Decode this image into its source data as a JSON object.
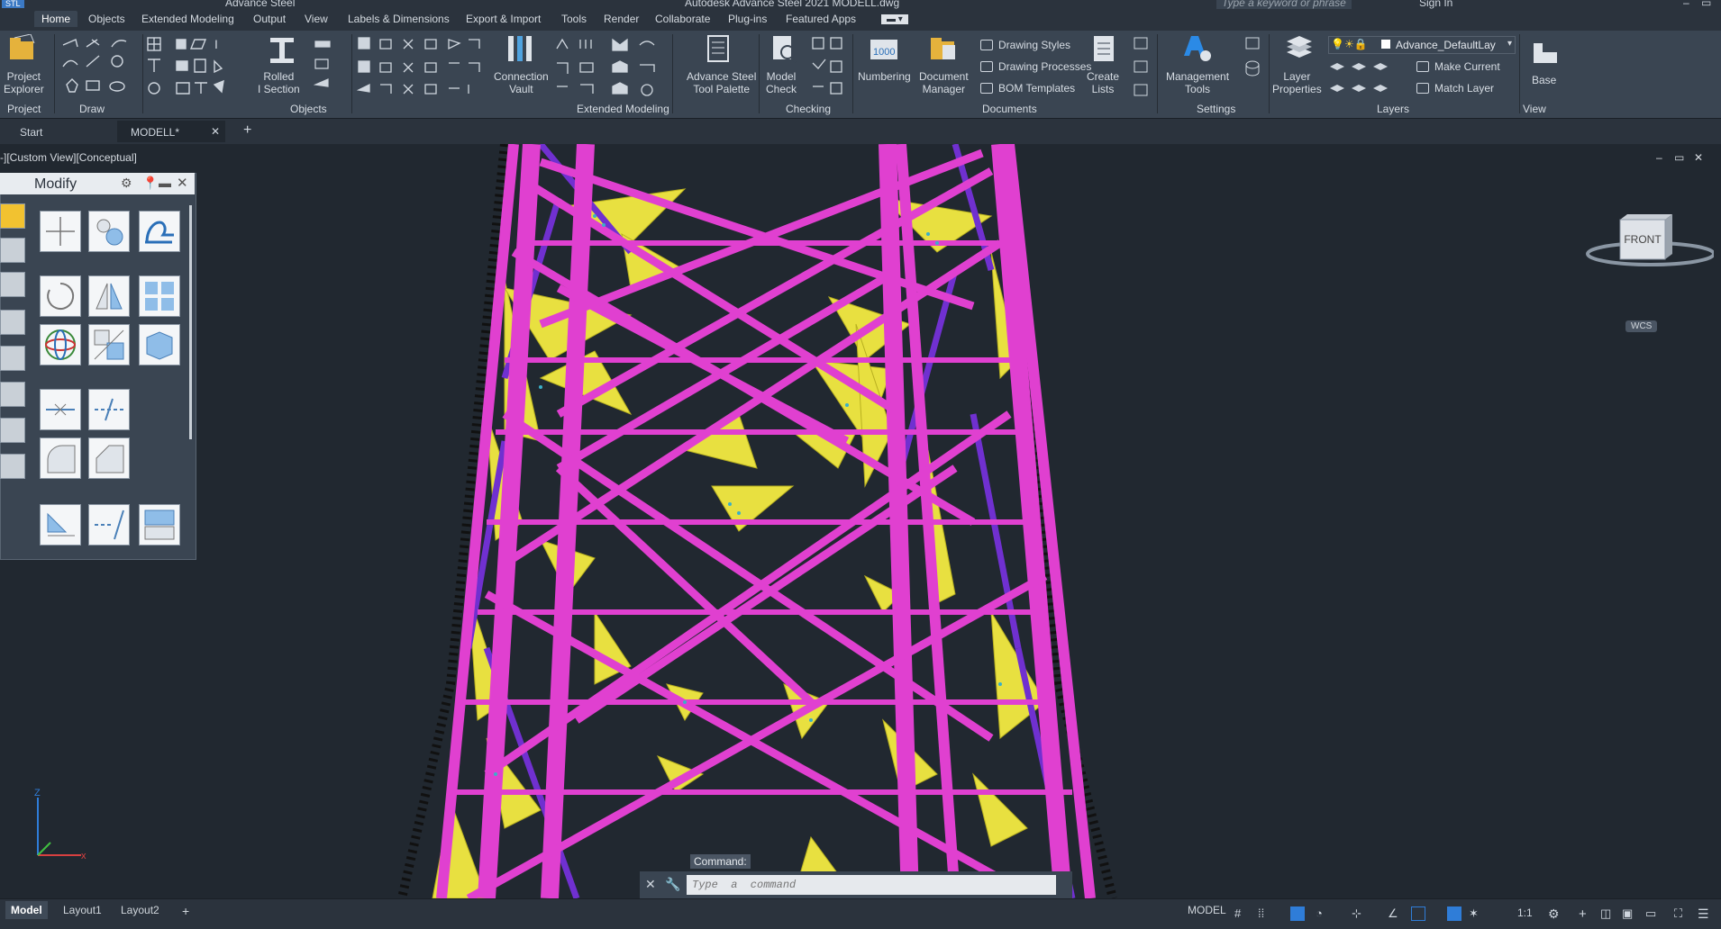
{
  "window": {
    "app_badge": "STL",
    "workspace": "Advance Steel",
    "title": "Autodesk Advance Steel 2021    MODELL.dwg",
    "search_placeholder": "Type a keyword or phrase",
    "sign_in": "Sign In"
  },
  "menu_tabs": [
    "Home",
    "Objects",
    "Extended Modeling",
    "Output",
    "View",
    "Labels & Dimensions",
    "Export & Import",
    "Tools",
    "Render",
    "Collaborate",
    "Plug-ins",
    "Featured Apps"
  ],
  "ribbon": {
    "project_explorer": "Project\nExplorer",
    "rolled_section": "Rolled\nI Section",
    "connection_vault": "Connection\nVault",
    "tool_palette": "Advance Steel\nTool Palette",
    "model_check": "Model\nCheck",
    "numbering": "Numbering",
    "document_manager": "Document\nManager",
    "drawing_styles": "Drawing Styles",
    "drawing_processes": "Drawing Processes",
    "bom_templates": "BOM Templates",
    "create_lists": "Create\nLists",
    "management_tools": "Management\nTools",
    "layer_properties": "Layer\nProperties",
    "layer_current": "Advance_DefaultLay",
    "make_current": "Make Current",
    "match_layer": "Match Layer",
    "base": "Base",
    "group_labels": [
      "Project",
      "Draw",
      "Objects",
      "Extended Modeling",
      "Checking",
      "Documents",
      "Settings",
      "Layers",
      "View"
    ]
  },
  "doc_tabs": [
    "Start",
    "MODELL*"
  ],
  "viewport": {
    "view_label": "-][Custom View][Conceptual]",
    "viewcube_face": "FRONT",
    "wcs": "WCS",
    "axis_z": "Z",
    "colors": {
      "steel": "#e040d0",
      "plate": "#e8e040",
      "bracing": "#7030d0",
      "background": "#212830"
    }
  },
  "palette": {
    "title": "Modify"
  },
  "command": {
    "label": "Command:",
    "placeholder": "Type  a  command"
  },
  "layout_tabs": [
    "Model",
    "Layout1",
    "Layout2"
  ],
  "status": {
    "model": "MODEL",
    "scale": "1:1"
  }
}
